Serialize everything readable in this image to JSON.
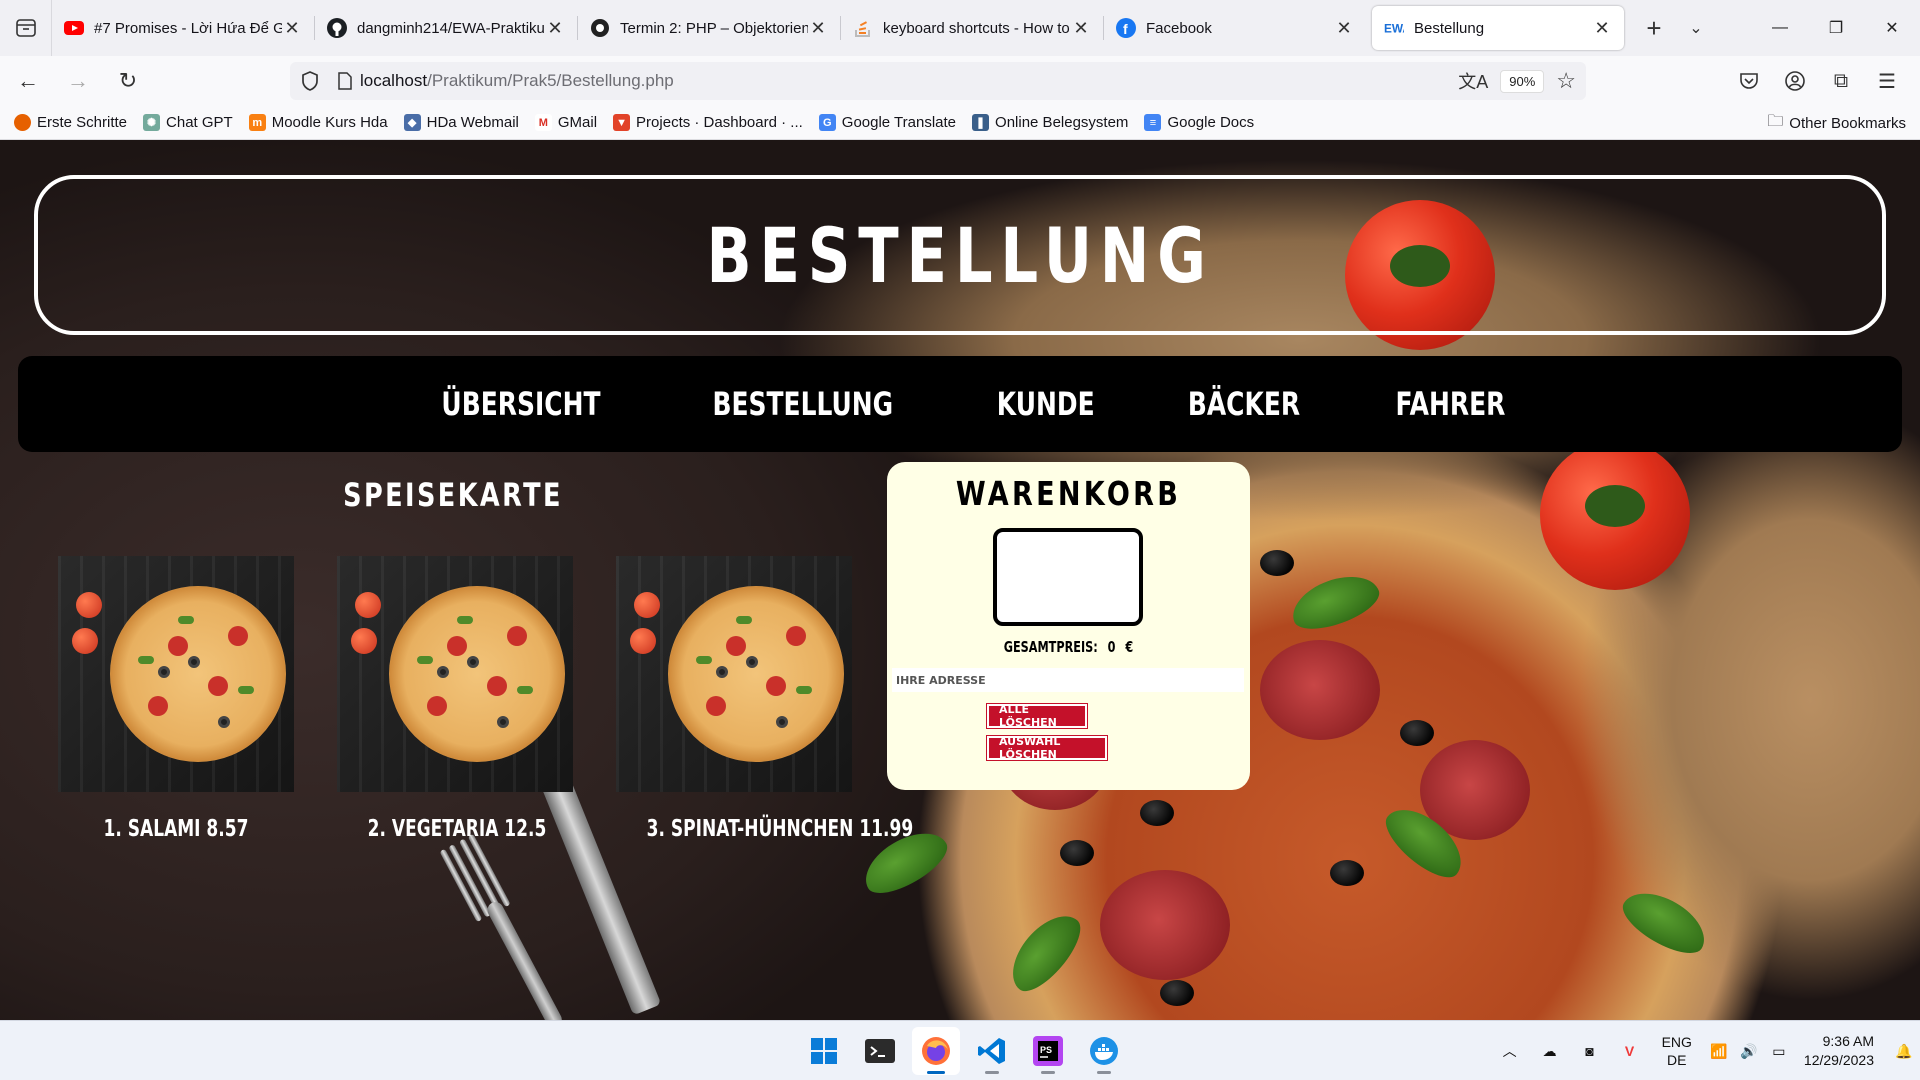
{
  "browser": {
    "tabs": [
      {
        "title": "#7 Promises - Lời Hứa Để G",
        "icon": "youtube-icon",
        "active": false
      },
      {
        "title": "dangminh214/EWA-Praktiku",
        "icon": "github-icon",
        "active": false
      },
      {
        "title": "Termin 2: PHP – Objektorien",
        "icon": "moodle-icon",
        "active": false
      },
      {
        "title": "keyboard shortcuts - How to",
        "icon": "stackoverflow-icon",
        "active": false
      },
      {
        "title": "Facebook",
        "icon": "facebook-icon",
        "active": false
      },
      {
        "title": "Bestellung",
        "icon": "ewa-icon",
        "active": true
      }
    ],
    "url_host": "localhost",
    "url_path": "/Praktikum/Prak5/Bestellung.php",
    "zoom": "90%",
    "bookmarks": [
      {
        "label": "Erste Schritte",
        "icon": "firefox-icon",
        "color": "#e66000"
      },
      {
        "label": "Chat GPT",
        "icon": "chatgpt-icon",
        "color": "#74aa9c"
      },
      {
        "label": "Moodle Kurs Hda",
        "icon": "moodle-icon",
        "color": "#f98012"
      },
      {
        "label": "HDa Webmail",
        "icon": "webmail-icon",
        "color": "#4a6da7"
      },
      {
        "label": "GMail",
        "icon": "gmail-icon",
        "color": "#d93025"
      },
      {
        "label": "Projects · Dashboard · ...",
        "icon": "gitlab-icon",
        "color": "#e24329"
      },
      {
        "label": "Google Translate",
        "icon": "translate-icon",
        "color": "#4285f4"
      },
      {
        "label": "Online Belegsystem",
        "icon": "belegsystem-icon",
        "color": "#3a5f8a"
      },
      {
        "label": "Google Docs",
        "icon": "docs-icon",
        "color": "#4285f4"
      }
    ],
    "other_bookmarks": "Other Bookmarks"
  },
  "page": {
    "header_title": "BESTELLUNG",
    "nav": [
      "ÜBERSICHT",
      "BESTELLUNG",
      "KUNDE",
      "BÄCKER",
      "FAHRER"
    ],
    "menu_heading": "SPEISEKARTE",
    "pizzas": [
      {
        "label": "1. SALAMI 8.57"
      },
      {
        "label": "2. VEGETARIA 12.5"
      },
      {
        "label": "3. SPINAT-HÜHNCHEN 11.99"
      }
    ],
    "cart": {
      "title": "WARENKORB",
      "total_label": "GESAMTPREIS:",
      "total_value": "0",
      "currency": "€",
      "address_placeholder": "IHRE ADRESSE",
      "clear_all": "ALLE LÖSCHEN",
      "clear_selection": "AUSWAHL LÖSCHEN"
    }
  },
  "taskbar": {
    "apps": [
      "windows-start-icon",
      "terminal-icon",
      "firefox-icon",
      "vscode-icon",
      "phpstorm-icon",
      "docker-icon"
    ],
    "language": "ENG",
    "region": "DE",
    "time": "9:36 AM",
    "date": "12/29/2023"
  }
}
